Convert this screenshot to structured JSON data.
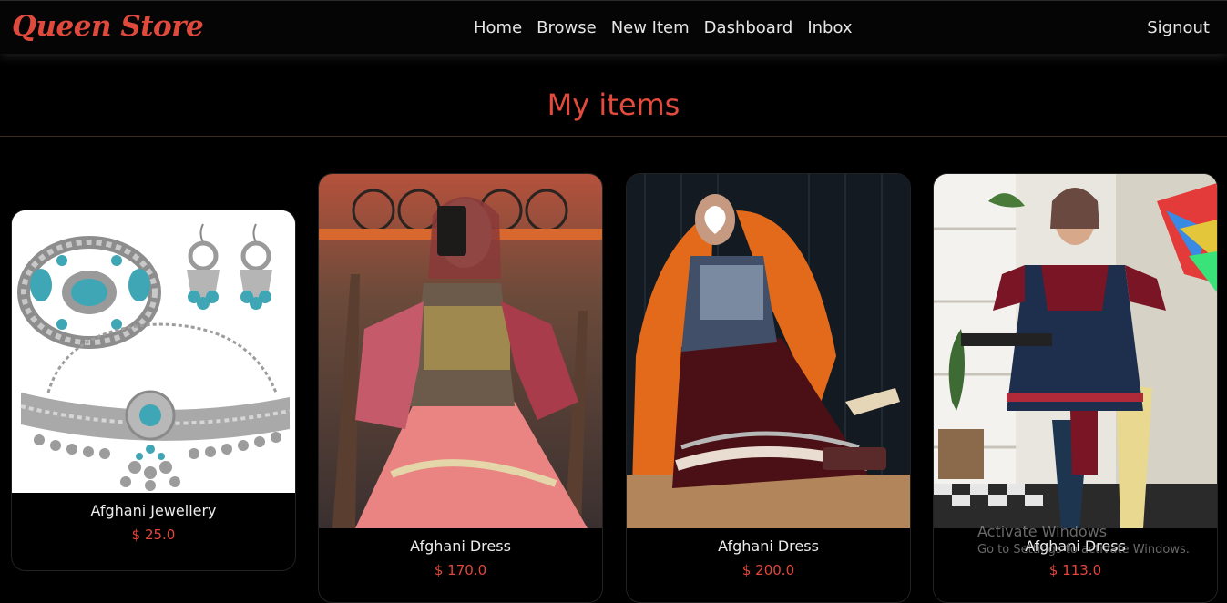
{
  "brand": "Queen Store",
  "nav": {
    "items": [
      "Home",
      "Browse",
      "New Item",
      "Dashboard",
      "Inbox"
    ],
    "signout": "Signout"
  },
  "page_title": "My items",
  "items": [
    {
      "name": "Afghani Jewellery",
      "price": "$ 25.0"
    },
    {
      "name": "Afghani Dress",
      "price": "$ 170.0"
    },
    {
      "name": "Afghani Dress",
      "price": "$ 200.0"
    },
    {
      "name": "Afghani Dress",
      "price": "$ 113.0"
    }
  ],
  "watermark": {
    "title": "Activate Windows",
    "subtitle": "Go to Settings to activate Windows."
  },
  "colors": {
    "accent": "#e24b3d",
    "background": "#000000",
    "nav_text": "#e6e6e6"
  }
}
